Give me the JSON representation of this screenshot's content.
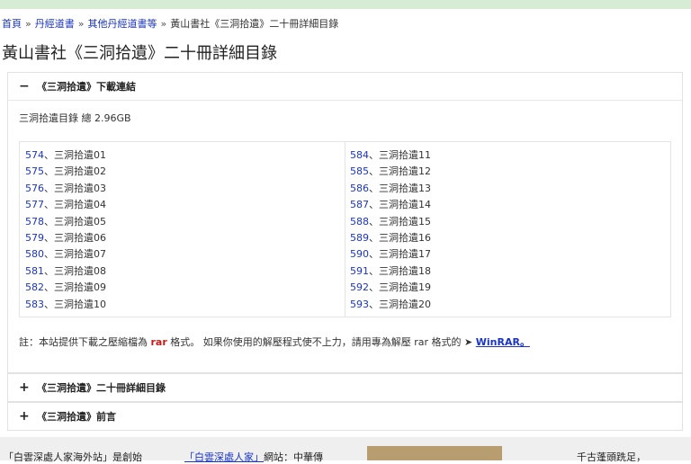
{
  "breadcrumb": {
    "items": [
      "首頁",
      "丹經道書",
      "其他丹經道書等"
    ],
    "current": "黃山書社《三洞拾遺》二十冊詳細目錄",
    "separator": "»"
  },
  "page_title": "黃山書社《三洞拾遺》二十冊詳細目錄",
  "panel_main": {
    "toggle": "−",
    "title": "《三洞拾遺》下載連結",
    "summary": "三洞拾遺目錄 總 2.96GB",
    "left_links": [
      {
        "num": "574",
        "name": "三洞拾遺01"
      },
      {
        "num": "575",
        "name": "三洞拾遺02"
      },
      {
        "num": "576",
        "name": "三洞拾遺03"
      },
      {
        "num": "577",
        "name": "三洞拾遺04"
      },
      {
        "num": "578",
        "name": "三洞拾遺05"
      },
      {
        "num": "579",
        "name": "三洞拾遺06"
      },
      {
        "num": "580",
        "name": "三洞拾遺07"
      },
      {
        "num": "581",
        "name": "三洞拾遺08"
      },
      {
        "num": "582",
        "name": "三洞拾遺09"
      },
      {
        "num": "583",
        "name": "三洞拾遺10"
      }
    ],
    "right_links": [
      {
        "num": "584",
        "name": "三洞拾遺11"
      },
      {
        "num": "585",
        "name": "三洞拾遺12"
      },
      {
        "num": "586",
        "name": "三洞拾遺13"
      },
      {
        "num": "587",
        "name": "三洞拾遺14"
      },
      {
        "num": "588",
        "name": "三洞拾遺15"
      },
      {
        "num": "589",
        "name": "三洞拾遺16"
      },
      {
        "num": "590",
        "name": "三洞拾遺17"
      },
      {
        "num": "591",
        "name": "三洞拾遺18"
      },
      {
        "num": "592",
        "name": "三洞拾遺19"
      },
      {
        "num": "593",
        "name": "三洞拾遺20"
      }
    ],
    "note": {
      "prefix": "註：本站提供下載之壓縮檔為 ",
      "rar": "rar",
      "middle": " 格式。 如果你使用的解壓程式使不上力，請用專為解壓  rar 格式的 ➤ ",
      "winrar": "WinRAR。"
    }
  },
  "panel_2": {
    "toggle": "+",
    "title": "《三洞拾遺》二十冊詳細目錄"
  },
  "panel_3": {
    "toggle": "+",
    "title": "《三洞拾遺》前言"
  },
  "bottom": {
    "text1": "「白雲深處人家海外站」是創始",
    "text2_link": "「白雲深處人家」",
    "text2_rest": "網站：中華傳",
    "text3": "千古蓬頭跣足，"
  },
  "colors": {
    "link": "#1a35c4",
    "rar": "#c81c1c",
    "topbar": "#d7ecd5"
  }
}
